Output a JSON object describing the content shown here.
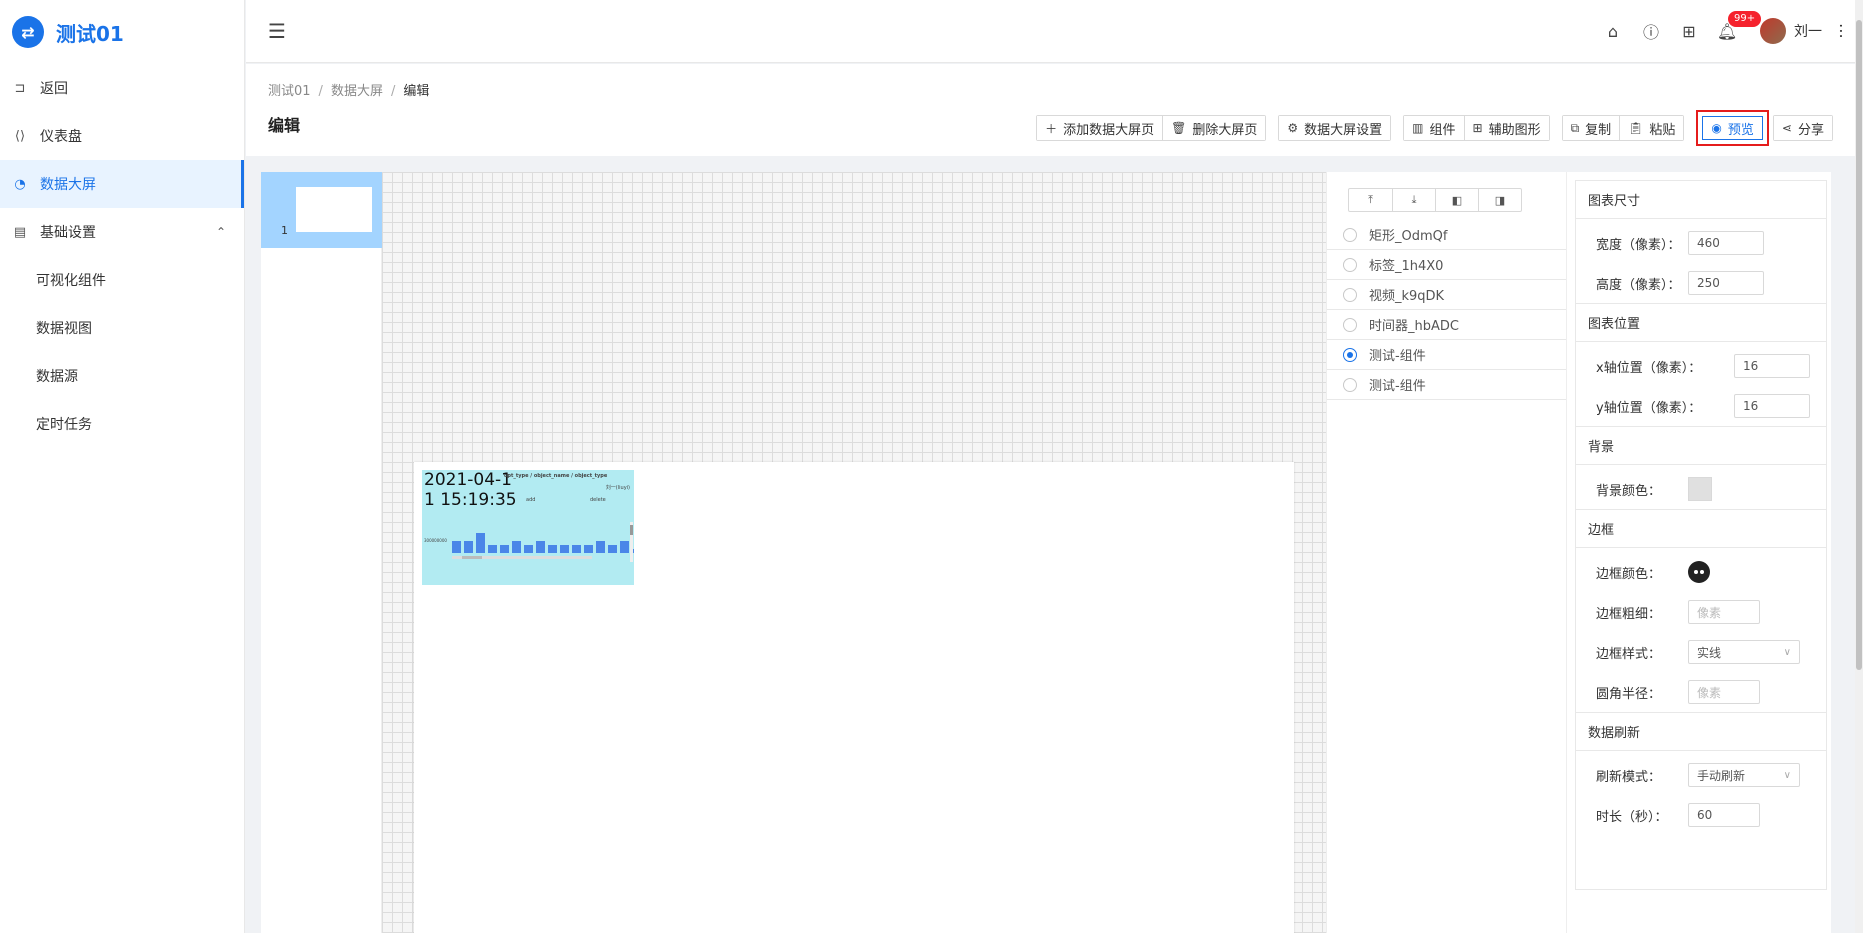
{
  "app": {
    "logo_glyph": "⇄",
    "title": "测试01",
    "accent": "#1a73e8"
  },
  "sidebar": {
    "items": [
      {
        "label": "返回",
        "icon": "return-icon"
      },
      {
        "label": "仪表盘",
        "icon": "dashboard-icon"
      },
      {
        "label": "数据大屏",
        "icon": "pie-chart-icon",
        "active": true
      },
      {
        "label": "基础设置",
        "icon": "settings-icon",
        "expanded": true
      }
    ],
    "subitems": [
      {
        "label": "可视化组件"
      },
      {
        "label": "数据视图"
      },
      {
        "label": "数据源"
      },
      {
        "label": "定时任务"
      }
    ]
  },
  "header": {
    "notification_count": "99+",
    "username": "刘一"
  },
  "breadcrumb": [
    "测试01",
    "数据大屏",
    "编辑"
  ],
  "page_title": "编辑",
  "toolbar": {
    "add_page": "添加数据大屏页",
    "delete_page": "删除大屏页",
    "settings": "数据大屏设置",
    "components": "组件",
    "aux_shapes": "辅助图形",
    "copy": "复制",
    "paste": "粘贴",
    "preview": "预览",
    "share": "分享"
  },
  "thumbnails": [
    {
      "number": "1"
    }
  ],
  "widget": {
    "time_text": "2021-04-1\n1 15:19:35",
    "subtitle": "opt_type / object_name / object_type",
    "legend": "刘一(liuyi)",
    "label_add": "add",
    "label_delete": "delete",
    "y_axis": "300000000",
    "bar_values": [
      3,
      3,
      5,
      2,
      2,
      3,
      2,
      3,
      2,
      2,
      2,
      2,
      3,
      2,
      3,
      1
    ]
  },
  "layers": [
    {
      "name": "矩形_OdmQf",
      "selected": false
    },
    {
      "name": "标签_1h4X0",
      "selected": false
    },
    {
      "name": "视频_k9qDK",
      "selected": false
    },
    {
      "name": "时间器_hbADC",
      "selected": false
    },
    {
      "name": "测试-组件",
      "selected": true
    },
    {
      "name": "测试-组件",
      "selected": false
    }
  ],
  "props": {
    "size_title": "图表尺寸",
    "width_label": "宽度（像素）：",
    "width_value": "460",
    "height_label": "高度（像素）：",
    "height_value": "250",
    "position_title": "图表位置",
    "x_label": "x轴位置（像素）：",
    "x_value": "16",
    "y_label": "y轴位置（像素）：",
    "y_value": "16",
    "bg_title": "背景",
    "bg_color_label": "背景颜色：",
    "border_title": "边框",
    "border_color_label": "边框颜色：",
    "border_width_label": "边框粗细：",
    "border_width_placeholder": "像素",
    "border_style_label": "边框样式：",
    "border_style_value": "实线",
    "radius_label": "圆角半径：",
    "radius_placeholder": "像素",
    "refresh_title": "数据刷新",
    "refresh_mode_label": "刷新模式：",
    "refresh_mode_value": "手动刷新",
    "duration_label": "时长（秒）：",
    "duration_value": "60"
  }
}
